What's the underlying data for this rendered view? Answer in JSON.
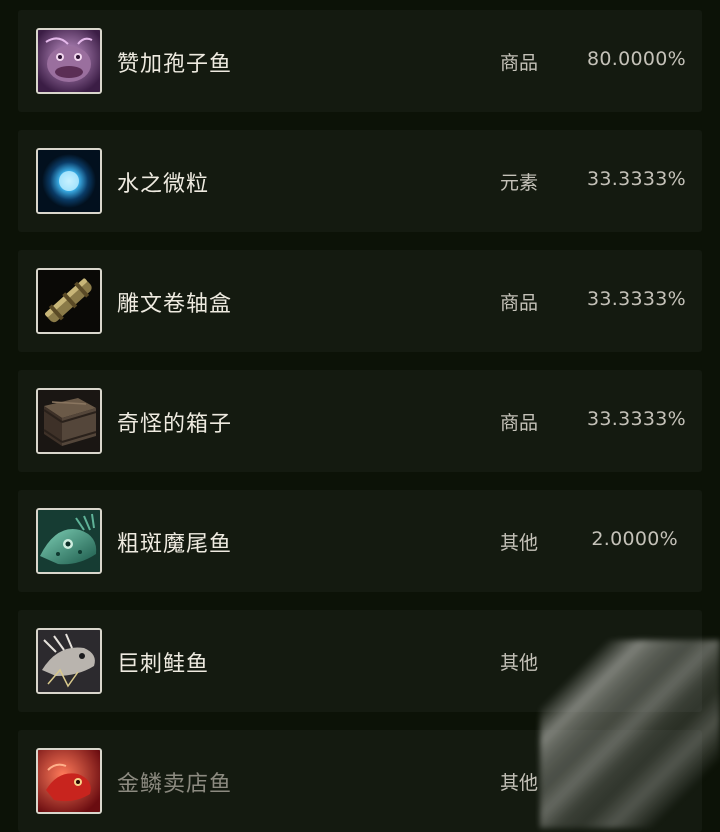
{
  "items": [
    {
      "name": "赞加孢子鱼",
      "type": "商品",
      "pct": "80.0000%",
      "icon": "spore-fish-icon"
    },
    {
      "name": "水之微粒",
      "type": "元素",
      "pct": "33.3333%",
      "icon": "water-mote-icon"
    },
    {
      "name": "雕文卷轴盒",
      "type": "商品",
      "pct": "33.3333%",
      "icon": "scroll-case-icon"
    },
    {
      "name": "奇怪的箱子",
      "type": "商品",
      "pct": "33.3333%",
      "icon": "wooden-crate-icon"
    },
    {
      "name": "粗斑魔尾鱼",
      "type": "其他",
      "pct": "2.0000%",
      "icon": "spotted-fish-icon"
    },
    {
      "name": "巨刺鲑鱼",
      "type": "其他",
      "pct": "",
      "icon": "spiny-salmon-icon"
    },
    {
      "name": "金鳞卖店鱼",
      "type": "其他",
      "pct": "",
      "icon": "goldscale-fish-icon"
    }
  ],
  "colors": {
    "background": "#0c1207",
    "row": "#141a10",
    "text": "#eeeae0",
    "muted": "#c4c1b8"
  }
}
